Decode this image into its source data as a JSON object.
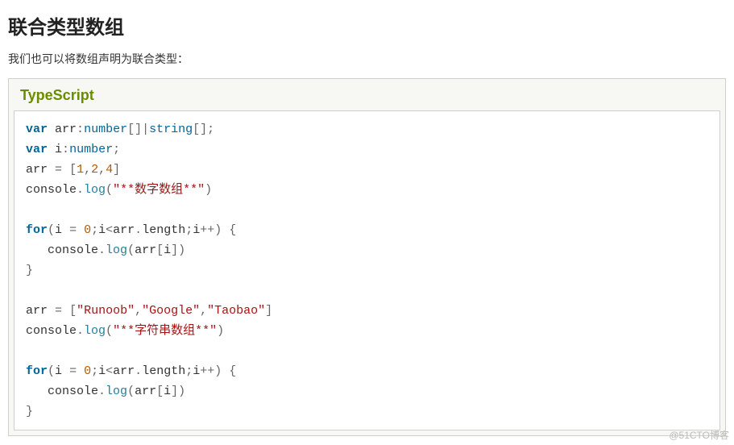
{
  "heading": "联合类型数组",
  "description": "我们也可以将数组声明为联合类型：",
  "codebox": {
    "language_label": "TypeScript"
  },
  "code": {
    "kw_var": "var",
    "kw_for": "for",
    "id_arr": "arr",
    "id_i": "i",
    "id_console": "console",
    "id_log": "log",
    "id_length": "length",
    "type_number": "number",
    "type_string": "string",
    "num_1": "1",
    "num_2": "2",
    "num_4": "4",
    "num_0": "0",
    "str_num_array": "\"**数字数组**\"",
    "str_runoob": "\"Runoob\"",
    "str_google": "\"Google\"",
    "str_taobao": "\"Taobao\"",
    "str_str_array": "\"**字符串数组**\"",
    "colon": ":",
    "semicolon": ";",
    "lbracket": "[",
    "rbracket": "]",
    "pipe": "|",
    "equals": "=",
    "comma": ",",
    "lparen": "(",
    "rparen": ")",
    "dot": ".",
    "lt": "<",
    "inc": "++",
    "lbrace": "{",
    "rbrace": "}"
  },
  "watermark": "@51CTO博客"
}
